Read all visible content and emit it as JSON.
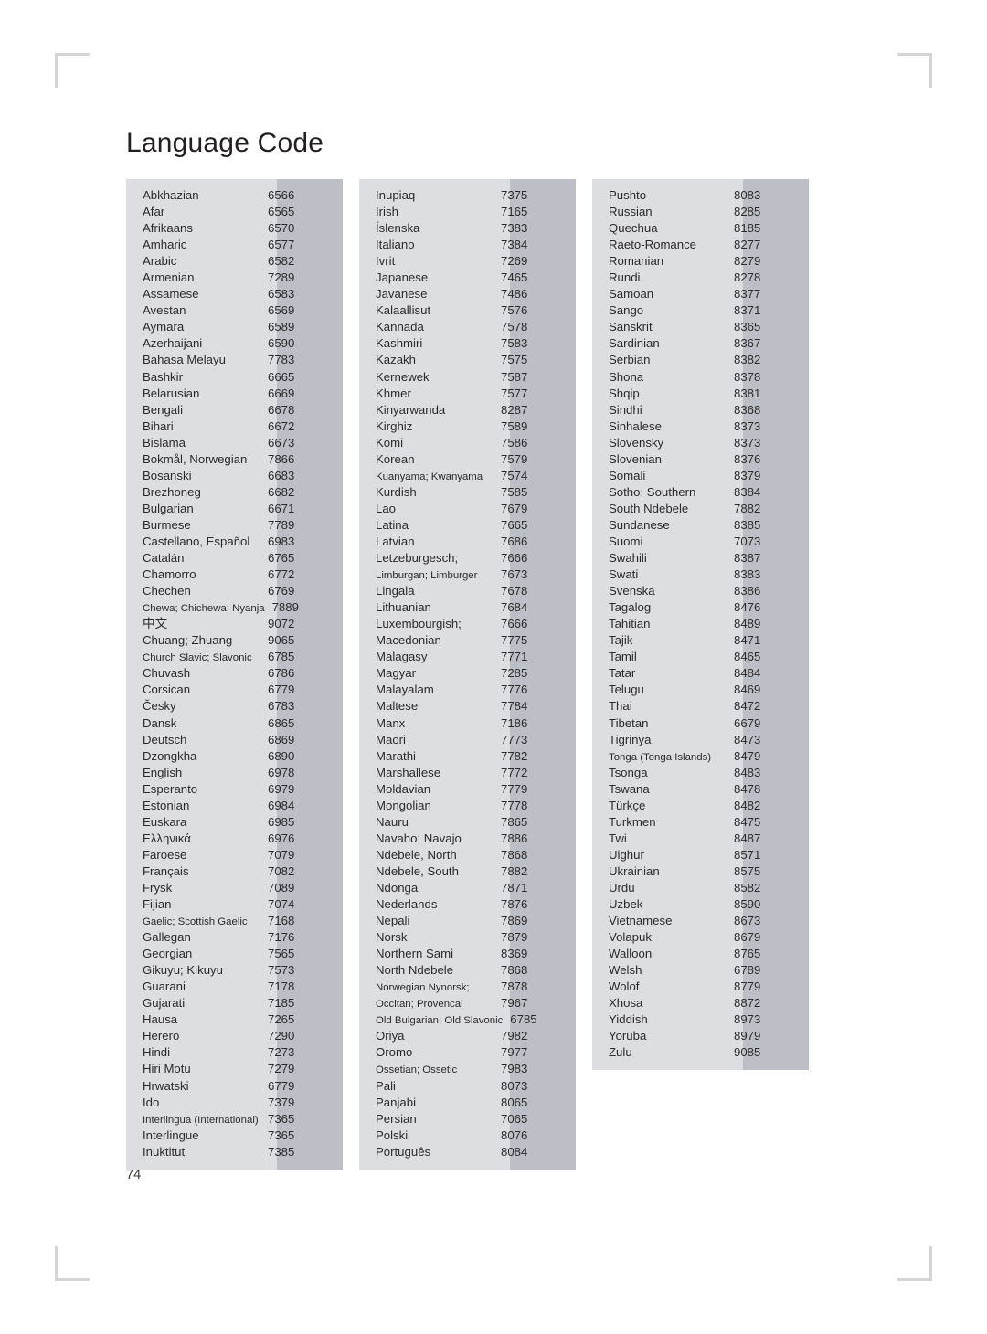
{
  "document": {
    "title": "Language Code",
    "page_number": "74"
  },
  "columns": [
    {
      "id": "column-1",
      "rows": [
        {
          "name": "Abkhazian",
          "code": "6566"
        },
        {
          "name": "Afar",
          "code": "6565"
        },
        {
          "name": "Afrikaans",
          "code": "6570"
        },
        {
          "name": "Amharic",
          "code": "6577"
        },
        {
          "name": "Arabic",
          "code": "6582"
        },
        {
          "name": "Armenian",
          "code": "7289"
        },
        {
          "name": "Assamese",
          "code": "6583"
        },
        {
          "name": "Avestan",
          "code": "6569"
        },
        {
          "name": "Aymara",
          "code": "6589"
        },
        {
          "name": "Azerhaijani",
          "code": "6590"
        },
        {
          "name": "Bahasa Melayu",
          "code": "7783"
        },
        {
          "name": "Bashkir",
          "code": "6665"
        },
        {
          "name": "Belarusian",
          "code": "6669"
        },
        {
          "name": "Bengali",
          "code": "6678"
        },
        {
          "name": "Bihari",
          "code": "6672"
        },
        {
          "name": "Bislama",
          "code": "6673"
        },
        {
          "name": "Bokmål, Norwegian",
          "code": "7866"
        },
        {
          "name": "Bosanski",
          "code": "6683"
        },
        {
          "name": "Brezhoneg",
          "code": "6682"
        },
        {
          "name": "Bulgarian",
          "code": "6671"
        },
        {
          "name": "Burmese",
          "code": "7789"
        },
        {
          "name": "Castellano, Español",
          "code": "6983"
        },
        {
          "name": "Catalán",
          "code": "6765"
        },
        {
          "name": "Chamorro",
          "code": "6772"
        },
        {
          "name": "Chechen",
          "code": "6769"
        },
        {
          "name": "Chewa; Chichewa; Nyanja",
          "code": "7889",
          "tight": true
        },
        {
          "name": "中文",
          "code": "9072",
          "cjk": true
        },
        {
          "name": "Chuang; Zhuang",
          "code": "9065"
        },
        {
          "name": "Church Slavic; Slavonic",
          "code": "6785",
          "tight": true
        },
        {
          "name": "Chuvash",
          "code": "6786"
        },
        {
          "name": "Corsican",
          "code": "6779"
        },
        {
          "name": "Česky",
          "code": "6783"
        },
        {
          "name": "Dansk",
          "code": "6865"
        },
        {
          "name": "Deutsch",
          "code": "6869"
        },
        {
          "name": "Dzongkha",
          "code": "6890"
        },
        {
          "name": "English",
          "code": "6978"
        },
        {
          "name": "Esperanto",
          "code": "6979"
        },
        {
          "name": "Estonian",
          "code": "6984"
        },
        {
          "name": "Euskara",
          "code": "6985"
        },
        {
          "name": "Ελληνικά",
          "code": "6976"
        },
        {
          "name": "Faroese",
          "code": "7079"
        },
        {
          "name": "Français",
          "code": "7082"
        },
        {
          "name": "Frysk",
          "code": "7089"
        },
        {
          "name": "Fijian",
          "code": "7074"
        },
        {
          "name": "Gaelic; Scottish Gaelic",
          "code": "7168",
          "tight": true
        },
        {
          "name": "Gallegan",
          "code": "7176"
        },
        {
          "name": "Georgian",
          "code": "7565"
        },
        {
          "name": "Gikuyu; Kikuyu",
          "code": "7573"
        },
        {
          "name": "Guarani",
          "code": "7178"
        },
        {
          "name": "Gujarati",
          "code": "7185"
        },
        {
          "name": "Hausa",
          "code": "7265"
        },
        {
          "name": "Herero",
          "code": "7290"
        },
        {
          "name": "Hindi",
          "code": "7273"
        },
        {
          "name": "Hiri Motu",
          "code": "7279"
        },
        {
          "name": "Hrwatski",
          "code": "6779"
        },
        {
          "name": "Ido",
          "code": "7379"
        },
        {
          "name": "Interlingua (International)",
          "code": "7365",
          "tight": true
        },
        {
          "name": "Interlingue",
          "code": "7365"
        },
        {
          "name": "Inuktitut",
          "code": "7385"
        }
      ]
    },
    {
      "id": "column-2",
      "rows": [
        {
          "name": "Inupiaq",
          "code": "7375"
        },
        {
          "name": "Irish",
          "code": "7165"
        },
        {
          "name": "Íslenska",
          "code": "7383"
        },
        {
          "name": "Italiano",
          "code": "7384"
        },
        {
          "name": "Ivrit",
          "code": "7269"
        },
        {
          "name": "Japanese",
          "code": "7465"
        },
        {
          "name": "Javanese",
          "code": "7486"
        },
        {
          "name": "Kalaallisut",
          "code": "7576"
        },
        {
          "name": "Kannada",
          "code": "7578"
        },
        {
          "name": "Kashmiri",
          "code": "7583"
        },
        {
          "name": "Kazakh",
          "code": "7575"
        },
        {
          "name": "Kernewek",
          "code": "7587"
        },
        {
          "name": "Khmer",
          "code": "7577"
        },
        {
          "name": "Kinyarwanda",
          "code": "8287"
        },
        {
          "name": "Kirghiz",
          "code": "7589"
        },
        {
          "name": "Komi",
          "code": "7586"
        },
        {
          "name": "Korean",
          "code": "7579"
        },
        {
          "name": "Kuanyama; Kwanyama",
          "code": "7574",
          "tight": true
        },
        {
          "name": "Kurdish",
          "code": "7585"
        },
        {
          "name": "Lao",
          "code": "7679"
        },
        {
          "name": "Latina",
          "code": "7665"
        },
        {
          "name": "Latvian",
          "code": "7686"
        },
        {
          "name": "Letzeburgesch;",
          "code": "7666"
        },
        {
          "name": "Limburgan; Limburger",
          "code": "7673",
          "tight": true
        },
        {
          "name": "Lingala",
          "code": "7678"
        },
        {
          "name": "Lithuanian",
          "code": "7684"
        },
        {
          "name": "Luxembourgish;",
          "code": "7666"
        },
        {
          "name": "Macedonian",
          "code": "7775"
        },
        {
          "name": "Malagasy",
          "code": "7771"
        },
        {
          "name": "Magyar",
          "code": "7285"
        },
        {
          "name": "Malayalam",
          "code": "7776"
        },
        {
          "name": "Maltese",
          "code": "7784"
        },
        {
          "name": "Manx",
          "code": "7186"
        },
        {
          "name": "Maori",
          "code": "7773"
        },
        {
          "name": "Marathi",
          "code": "7782"
        },
        {
          "name": "Marshallese",
          "code": "7772"
        },
        {
          "name": "Moldavian",
          "code": "7779"
        },
        {
          "name": "Mongolian",
          "code": "7778"
        },
        {
          "name": "Nauru",
          "code": "7865"
        },
        {
          "name": "Navaho; Navajo",
          "code": "7886"
        },
        {
          "name": "Ndebele, North",
          "code": "7868"
        },
        {
          "name": "Ndebele, South",
          "code": "7882"
        },
        {
          "name": "Ndonga",
          "code": "7871"
        },
        {
          "name": "Nederlands",
          "code": "7876"
        },
        {
          "name": "Nepali",
          "code": "7869"
        },
        {
          "name": "Norsk",
          "code": "7879"
        },
        {
          "name": "Northern Sami",
          "code": "8369"
        },
        {
          "name": "North Ndebele",
          "code": "7868"
        },
        {
          "name": "Norwegian Nynorsk;",
          "code": "7878",
          "tight": true
        },
        {
          "name": "Occitan; Provencal",
          "code": "7967",
          "tight": true
        },
        {
          "name": "Old Bulgarian; Old Slavonic",
          "code": "6785",
          "tight": true
        },
        {
          "name": "Oriya",
          "code": "7982"
        },
        {
          "name": "Oromo",
          "code": "7977"
        },
        {
          "name": "Ossetian; Ossetic",
          "code": "7983",
          "tight": true
        },
        {
          "name": "Pali",
          "code": "8073"
        },
        {
          "name": "Panjabi",
          "code": "8065"
        },
        {
          "name": "Persian",
          "code": "7065"
        },
        {
          "name": "Polski",
          "code": "8076"
        },
        {
          "name": "Português",
          "code": "8084"
        }
      ]
    },
    {
      "id": "column-3",
      "rows": [
        {
          "name": "Pushto",
          "code": "8083"
        },
        {
          "name": "Russian",
          "code": "8285"
        },
        {
          "name": "Quechua",
          "code": "8185"
        },
        {
          "name": "Raeto-Romance",
          "code": "8277"
        },
        {
          "name": "Romanian",
          "code": "8279"
        },
        {
          "name": "Rundi",
          "code": "8278"
        },
        {
          "name": "Samoan",
          "code": "8377"
        },
        {
          "name": "Sango",
          "code": "8371"
        },
        {
          "name": "Sanskrit",
          "code": "8365"
        },
        {
          "name": "Sardinian",
          "code": "8367"
        },
        {
          "name": "Serbian",
          "code": "8382"
        },
        {
          "name": "Shona",
          "code": "8378"
        },
        {
          "name": "Shqip",
          "code": "8381"
        },
        {
          "name": "Sindhi",
          "code": "8368"
        },
        {
          "name": "Sinhalese",
          "code": "8373"
        },
        {
          "name": "Slovensky",
          "code": "8373"
        },
        {
          "name": "Slovenian",
          "code": "8376"
        },
        {
          "name": "Somali",
          "code": "8379"
        },
        {
          "name": "Sotho; Southern",
          "code": "8384"
        },
        {
          "name": "South Ndebele",
          "code": "7882"
        },
        {
          "name": "Sundanese",
          "code": "8385"
        },
        {
          "name": "Suomi",
          "code": "7073"
        },
        {
          "name": "Swahili",
          "code": "8387"
        },
        {
          "name": "Swati",
          "code": "8383"
        },
        {
          "name": "Svenska",
          "code": "8386"
        },
        {
          "name": "Tagalog",
          "code": "8476"
        },
        {
          "name": "Tahitian",
          "code": "8489"
        },
        {
          "name": "Tajik",
          "code": "8471"
        },
        {
          "name": "Tamil",
          "code": "8465"
        },
        {
          "name": "Tatar",
          "code": "8484"
        },
        {
          "name": "Telugu",
          "code": "8469"
        },
        {
          "name": "Thai",
          "code": "8472"
        },
        {
          "name": "Tibetan",
          "code": "6679"
        },
        {
          "name": "Tigrinya",
          "code": "8473"
        },
        {
          "name": "Tonga (Tonga Islands)",
          "code": "8479",
          "tight": true
        },
        {
          "name": "Tsonga",
          "code": "8483"
        },
        {
          "name": "Tswana",
          "code": "8478"
        },
        {
          "name": "Türkçe",
          "code": "8482"
        },
        {
          "name": "Turkmen",
          "code": "8475"
        },
        {
          "name": "Twi",
          "code": "8487"
        },
        {
          "name": "Uighur",
          "code": "8571"
        },
        {
          "name": "Ukrainian",
          "code": "8575"
        },
        {
          "name": "Urdu",
          "code": "8582"
        },
        {
          "name": "Uzbek",
          "code": "8590"
        },
        {
          "name": "Vietnamese",
          "code": "8673"
        },
        {
          "name": "Volapuk",
          "code": "8679"
        },
        {
          "name": "Walloon",
          "code": "8765"
        },
        {
          "name": "Welsh",
          "code": "6789"
        },
        {
          "name": "Wolof",
          "code": "8779"
        },
        {
          "name": "Xhosa",
          "code": "8872"
        },
        {
          "name": "Yiddish",
          "code": "8973"
        },
        {
          "name": "Yoruba",
          "code": "8979"
        },
        {
          "name": "Zulu",
          "code": "9085"
        }
      ]
    }
  ]
}
